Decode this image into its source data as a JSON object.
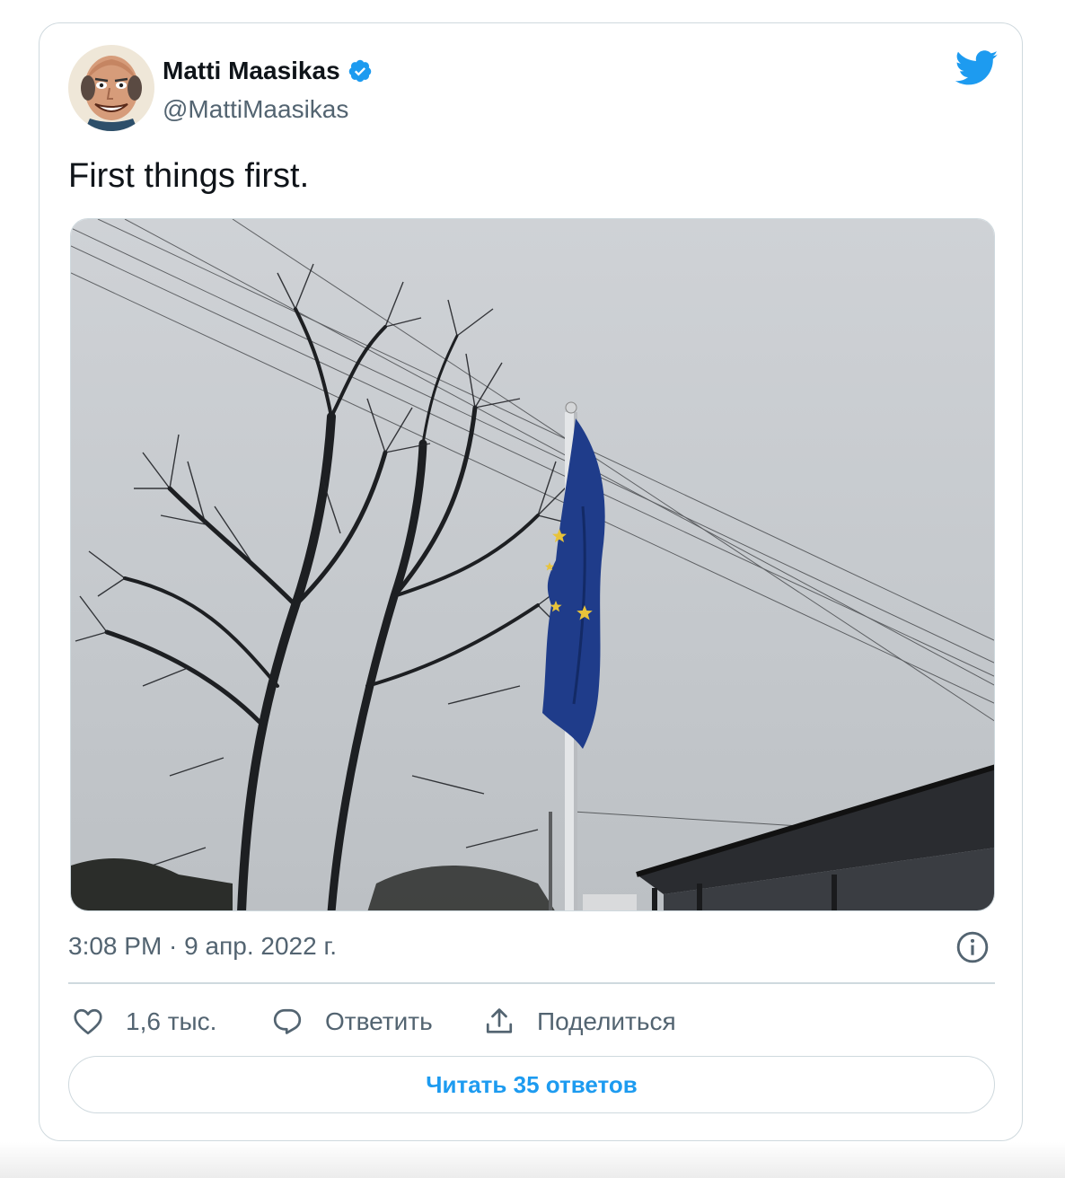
{
  "author": {
    "display_name": "Matti Maasikas",
    "handle": "@MattiMaasikas",
    "verified": true,
    "avatar_icon": "caricature-avatar"
  },
  "tweet": {
    "text": "First things first.",
    "timestamp": "3:08 PM · 9 апр. 2022 г."
  },
  "media": {
    "image_icon": "photo-eu-flag-bare-tree"
  },
  "actions": {
    "like_count": "1,6 тыс.",
    "reply_label": "Ответить",
    "share_label": "Поделиться"
  },
  "read_replies_label": "Читать 35 ответов",
  "colors": {
    "accent": "#1d9bf0",
    "secondary_text": "#536471",
    "border": "#cfd9de",
    "flag_blue": "#1f3c8a",
    "flag_star": "#e8c33a"
  }
}
